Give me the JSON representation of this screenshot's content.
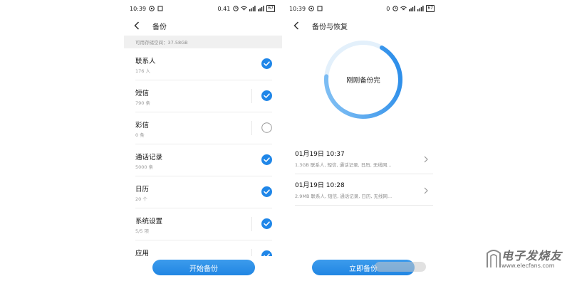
{
  "colors": {
    "accent": "#2186e3",
    "check": "#1f86e8",
    "ring_track": "#e3f0fb"
  },
  "phone1": {
    "status": {
      "time": "10:39",
      "net_speed": "0.41",
      "battery": "67"
    },
    "title": "备份",
    "storage": "可用存储空间：37.58GB",
    "items": [
      {
        "name": "联系人",
        "sub": "176 人",
        "checked": true,
        "divider": false
      },
      {
        "name": "短信",
        "sub": "790 条",
        "checked": true,
        "divider": true
      },
      {
        "name": "彩信",
        "sub": "0 条",
        "checked": false,
        "divider": true
      },
      {
        "name": "通话记录",
        "sub": "5000 条",
        "checked": true,
        "divider": false
      },
      {
        "name": "日历",
        "sub": "20 个",
        "checked": true,
        "divider": false
      },
      {
        "name": "系统设置",
        "sub": "5/5 项",
        "checked": true,
        "divider": true
      },
      {
        "name": "应用",
        "sub": "",
        "checked": true,
        "divider": true
      }
    ],
    "button": "开始备份"
  },
  "phone2": {
    "status": {
      "time": "10:39",
      "net_speed": "0",
      "battery": "67"
    },
    "title": "备份与恢复",
    "ring_text": "刚刚备份完",
    "ring_progress": 0.68,
    "records": [
      {
        "date": "01月19日 10:37",
        "detail": "1.3GB   联系人, 短信, 通话记录, 日历, 无线网..."
      },
      {
        "date": "01月19日 10:28",
        "detail": "2.9MB   联系人, 短信, 通话记录, 日历, 无线网..."
      }
    ],
    "button": "立即备份"
  },
  "watermark": {
    "text": "电子发烧友",
    "url": "www.elecfans.com"
  }
}
